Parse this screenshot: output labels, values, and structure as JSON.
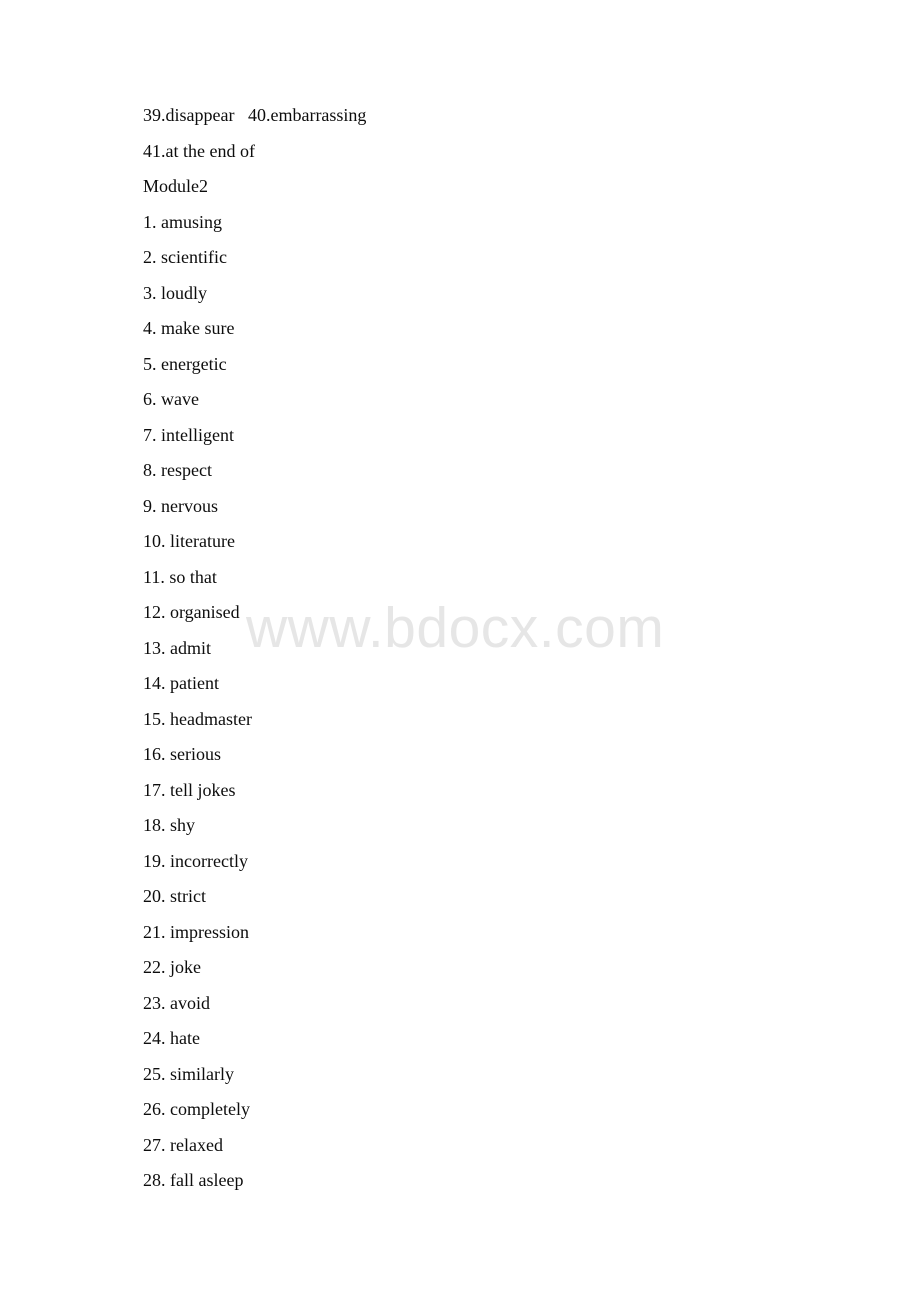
{
  "document": {
    "watermark": "www.bdocx.com",
    "lines": [
      {
        "id": "line-39-40",
        "text": "39.disappear   40.embarrassing"
      },
      {
        "id": "line-41",
        "text": "41.at the end of"
      },
      {
        "id": "module-heading",
        "text": "Module2"
      },
      {
        "id": "item-1",
        "text": "1. amusing"
      },
      {
        "id": "item-2",
        "text": "2. scientific"
      },
      {
        "id": "item-3",
        "text": "3. loudly"
      },
      {
        "id": "item-4",
        "text": "4. make sure"
      },
      {
        "id": "item-5",
        "text": "5. energetic"
      },
      {
        "id": "item-6",
        "text": "6. wave"
      },
      {
        "id": "item-7",
        "text": "7. intelligent"
      },
      {
        "id": "item-8",
        "text": "8. respect"
      },
      {
        "id": "item-9",
        "text": "9. nervous"
      },
      {
        "id": "item-10",
        "text": "10. literature"
      },
      {
        "id": "item-11",
        "text": "11. so that"
      },
      {
        "id": "item-12",
        "text": "12. organised"
      },
      {
        "id": "item-13",
        "text": "13. admit"
      },
      {
        "id": "item-14",
        "text": "14. patient"
      },
      {
        "id": "item-15",
        "text": "15. headmaster"
      },
      {
        "id": "item-16",
        "text": "16. serious"
      },
      {
        "id": "item-17",
        "text": "17. tell jokes"
      },
      {
        "id": "item-18",
        "text": "18. shy"
      },
      {
        "id": "item-19",
        "text": "19. incorrectly"
      },
      {
        "id": "item-20",
        "text": "20. strict"
      },
      {
        "id": "item-21",
        "text": "21. impression"
      },
      {
        "id": "item-22",
        "text": "22. joke"
      },
      {
        "id": "item-23",
        "text": "23. avoid"
      },
      {
        "id": "item-24",
        "text": "24. hate"
      },
      {
        "id": "item-25",
        "text": "25. similarly"
      },
      {
        "id": "item-26",
        "text": "26. completely"
      },
      {
        "id": "item-27",
        "text": "27. relaxed"
      },
      {
        "id": "item-28",
        "text": "28. fall asleep"
      }
    ]
  }
}
